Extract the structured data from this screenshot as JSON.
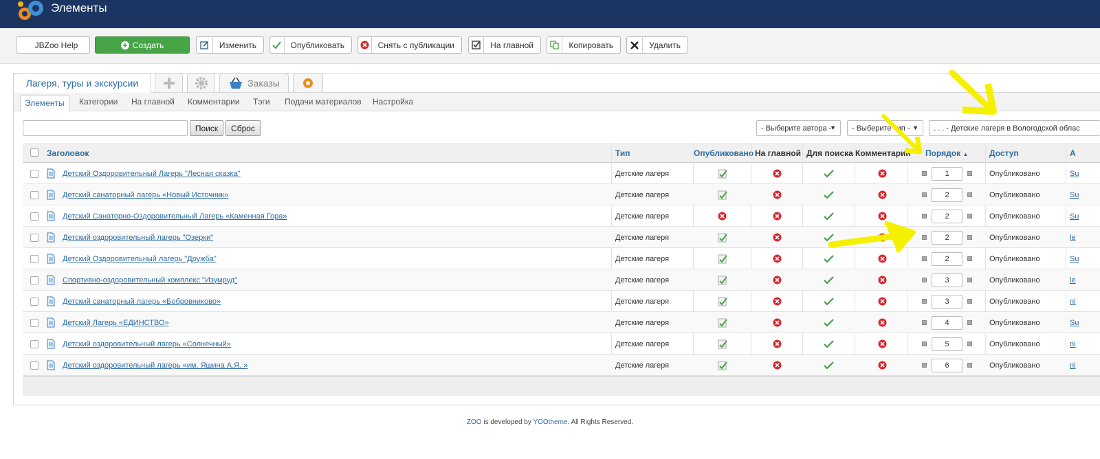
{
  "header": {
    "title": "Элементы"
  },
  "toolbar": {
    "help_label": "JBZoo Help",
    "create_label": "Создать",
    "edit_label": "Изменить",
    "publish_label": "Опубликовать",
    "unpublish_label": "Снять с публикации",
    "frontpage_label": "На главной",
    "copy_label": "Копировать",
    "delete_label": "Удалить"
  },
  "apptabs": {
    "main": "Лагеря, туры и экскурсии",
    "orders": "Заказы"
  },
  "subnav": [
    "Элементы",
    "Категории",
    "На главной",
    "Комментарии",
    "Тэги",
    "Подачи материалов",
    "Настройка"
  ],
  "filters": {
    "search_value": "",
    "search_button": "Поиск",
    "reset_button": "Сброс",
    "author": "- Выберите автора -",
    "type": "- Выберите тип -",
    "category": ". . . - Детские лагеря в Вологодской облас"
  },
  "columns": {
    "title": "Заголовок",
    "type": "Тип",
    "published": "Опубликовано",
    "frontpage": "На главной",
    "searchable": "Для поиска",
    "comments": "Комментарии",
    "order": "Порядок",
    "access": "Доступ",
    "author": "А"
  },
  "rows": [
    {
      "title": "Детский Оздоровительный Лагерь \"Лесная сказка\"",
      "type": "Детские лагеря",
      "published": true,
      "order": "1",
      "access": "Опубликовано",
      "author": "Su"
    },
    {
      "title": "Детский санаторный лагерь «Новый Источник»",
      "type": "Детские лагеря",
      "published": true,
      "order": "2",
      "access": "Опубликовано",
      "author": "Su"
    },
    {
      "title": "Детский Санаторно-Оздоровительный Лагерь «Каменная Гора»",
      "type": "Детские лагеря",
      "published": false,
      "order": "2",
      "access": "Опубликовано",
      "author": "Su"
    },
    {
      "title": "Детский оздоровительный лагерь \"Озерки\"",
      "type": "Детские лагеря",
      "published": true,
      "order": "2",
      "access": "Опубликовано",
      "author": "le"
    },
    {
      "title": "Детский Оздоровительный лагерь \"Дружба\"",
      "type": "Детские лагеря",
      "published": true,
      "order": "2",
      "access": "Опубликовано",
      "author": "Su"
    },
    {
      "title": "Спортивно-оздоровительный комплекс \"Изумруд\"",
      "type": "Детские лагеря",
      "published": true,
      "order": "3",
      "access": "Опубликовано",
      "author": "le"
    },
    {
      "title": "Детский санаторный лагерь «Бобровниково»",
      "type": "Детские лагеря",
      "published": true,
      "order": "3",
      "access": "Опубликовано",
      "author": "ni"
    },
    {
      "title": "Детский Лагерь «ЕДИНСТВО»",
      "type": "Детские лагеря",
      "published": true,
      "order": "4",
      "access": "Опубликовано",
      "author": "Su"
    },
    {
      "title": "Детский оздоровительный лагерь «Солнечный»",
      "type": "Детские лагеря",
      "published": true,
      "order": "5",
      "access": "Опубликовано",
      "author": "ni"
    },
    {
      "title": "Детский оздоровительный лагерь «им. Яшина А.Я. »",
      "type": "Детские лагеря",
      "published": true,
      "order": "6",
      "access": "Опубликовано",
      "author": "ni"
    }
  ],
  "footer": {
    "zoo": "ZOO",
    "mid": " is developed by ",
    "yootheme": "YOOtheme",
    "end": ". All Rights Reserved."
  },
  "colors": {
    "header_bg": "#1b3461",
    "link": "#2d6ca2",
    "create_green": "#47a447",
    "annotation_arrow": "#f5f000"
  }
}
